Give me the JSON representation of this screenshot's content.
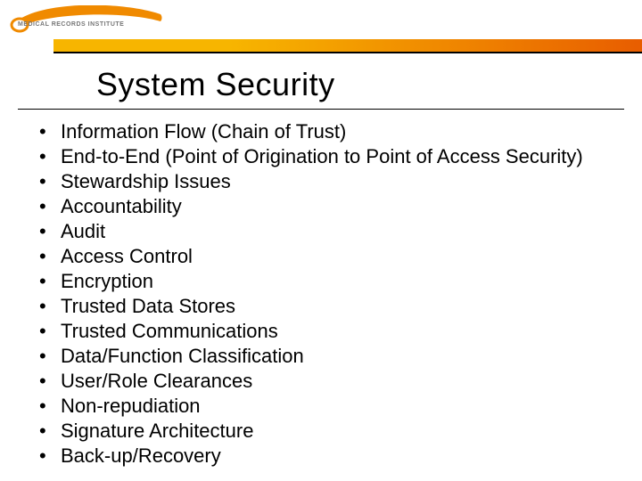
{
  "logo": {
    "text": "MEDICAL RECORDS INSTITUTE"
  },
  "title": "System Security",
  "bullets": [
    "Information Flow (Chain of Trust)",
    "End-to-End (Point of Origination to Point of Access Security)",
    "Stewardship Issues",
    "Accountability",
    "Audit",
    "Access Control",
    "Encryption",
    "Trusted Data Stores",
    "Trusted Communications",
    "Data/Function Classification",
    "User/Role Clearances",
    "Non-repudiation",
    "Signature Architecture",
    "Back-up/Recovery"
  ]
}
